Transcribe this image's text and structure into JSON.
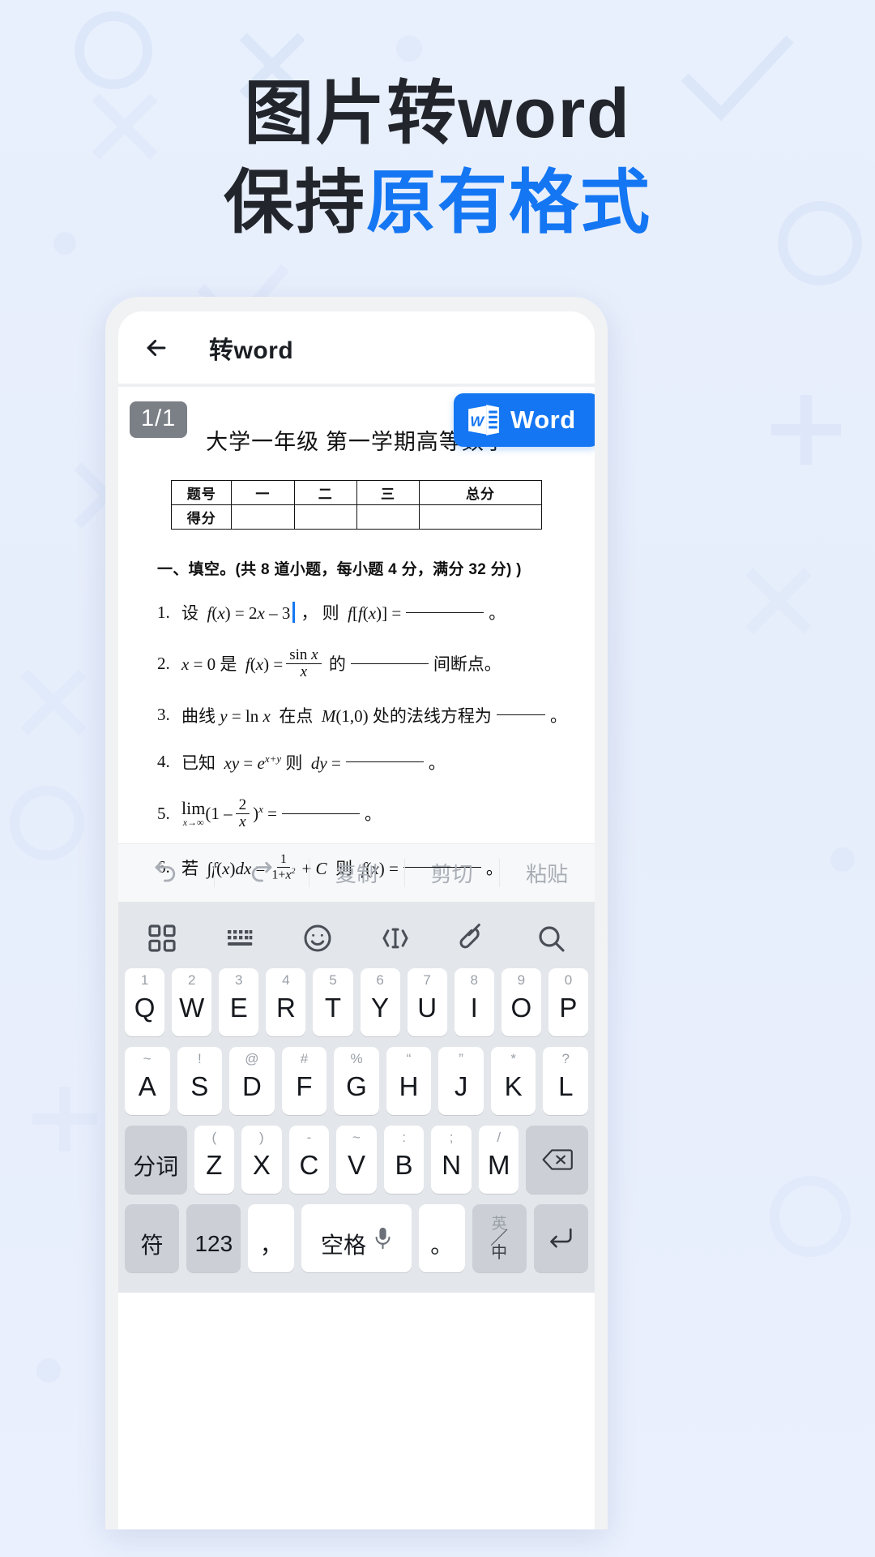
{
  "headline": {
    "line1": "图片转word",
    "line2_prefix": "保持",
    "line2_accent": "原有格式"
  },
  "colors": {
    "background": "#e8effc",
    "accent": "#1476f2",
    "headline_dark": "#22262c",
    "badge_gray": "#7b7f86",
    "keyboard_bg": "#e3e6eb",
    "key_white": "#ffffff",
    "key_gray": "#ccd0d6"
  },
  "appbar": {
    "back_icon": "arrow-left-icon",
    "title": "转word"
  },
  "document": {
    "page_badge": "1/1",
    "word_button": {
      "label": "Word",
      "icon": "word-logo-icon"
    },
    "title": "大学一年级 第一学期高等数学",
    "score_table": {
      "rows": [
        [
          "题号",
          "一",
          "二",
          "三",
          "总分"
        ],
        [
          "得分",
          "",
          "",
          "",
          ""
        ]
      ]
    },
    "section_heading": "一、填空。(共 8 道小题，每小题 4 分，满分 32 分) )",
    "questions": [
      {
        "num": "1.",
        "text": "设 f(x) = 2x－3 ， 则 f[f(x)] = ________ 。",
        "has_caret": true
      },
      {
        "num": "2.",
        "text": "x = 0 是 f(x) = sin x / x 的 ________ 间断点。"
      },
      {
        "num": "3.",
        "text": "曲线 y = ln x 在点 M(1,0) 处的法线方程为 ________ 。"
      },
      {
        "num": "4.",
        "text": "已知 xy = e^(x+y) 则 dy = ________ 。"
      },
      {
        "num": "5.",
        "text": "lim(x→∞)(1 － 2/x)^x = ________ 。"
      },
      {
        "num": "6.",
        "text": "若 ∫f(x)dx = 1/(1+x²) + C 则 f(x) = ________ 。"
      }
    ]
  },
  "edit_toolbar": {
    "items": [
      {
        "name": "undo",
        "icon": "undo-icon",
        "label": ""
      },
      {
        "name": "redo",
        "icon": "redo-icon",
        "label": ""
      },
      {
        "name": "copy",
        "icon": "",
        "label": "复制"
      },
      {
        "name": "cut",
        "icon": "",
        "label": "剪切"
      },
      {
        "name": "paste",
        "icon": "",
        "label": "粘贴"
      }
    ]
  },
  "keyboard": {
    "toolbar_icons": [
      "apps-grid-icon",
      "keyboard-icon",
      "emoji-icon",
      "text-cursor-icon",
      "clipboard-link-icon",
      "search-icon",
      "chevron-down-icon"
    ],
    "row1": [
      {
        "hint": "1",
        "key": "Q"
      },
      {
        "hint": "2",
        "key": "W"
      },
      {
        "hint": "3",
        "key": "E"
      },
      {
        "hint": "4",
        "key": "R"
      },
      {
        "hint": "5",
        "key": "T"
      },
      {
        "hint": "6",
        "key": "Y"
      },
      {
        "hint": "7",
        "key": "U"
      },
      {
        "hint": "8",
        "key": "I"
      },
      {
        "hint": "9",
        "key": "O"
      },
      {
        "hint": "0",
        "key": "P"
      }
    ],
    "row2": [
      {
        "hint": "~",
        "key": "A"
      },
      {
        "hint": "!",
        "key": "S"
      },
      {
        "hint": "@",
        "key": "D"
      },
      {
        "hint": "#",
        "key": "F"
      },
      {
        "hint": "%",
        "key": "G"
      },
      {
        "hint": "“",
        "key": "H"
      },
      {
        "hint": "”",
        "key": "J"
      },
      {
        "hint": "*",
        "key": "K"
      },
      {
        "hint": "?",
        "key": "L"
      }
    ],
    "row3_left": "分词",
    "row3": [
      {
        "hint": "(",
        "key": "Z"
      },
      {
        "hint": ")",
        "key": "X"
      },
      {
        "hint": "-",
        "key": "C"
      },
      {
        "hint": "~",
        "key": "V"
      },
      {
        "hint": ":",
        "key": "B"
      },
      {
        "hint": ";",
        "key": "N"
      },
      {
        "hint": "/",
        "key": "M"
      }
    ],
    "row3_right_icon": "backspace-icon",
    "row4": {
      "symbol": "符",
      "numbers": "123",
      "comma": "，",
      "space": "空格",
      "space_icon": "mic-icon",
      "period": "。",
      "lang_top": "英",
      "lang_bottom": "中",
      "enter_icon": "enter-icon"
    }
  }
}
